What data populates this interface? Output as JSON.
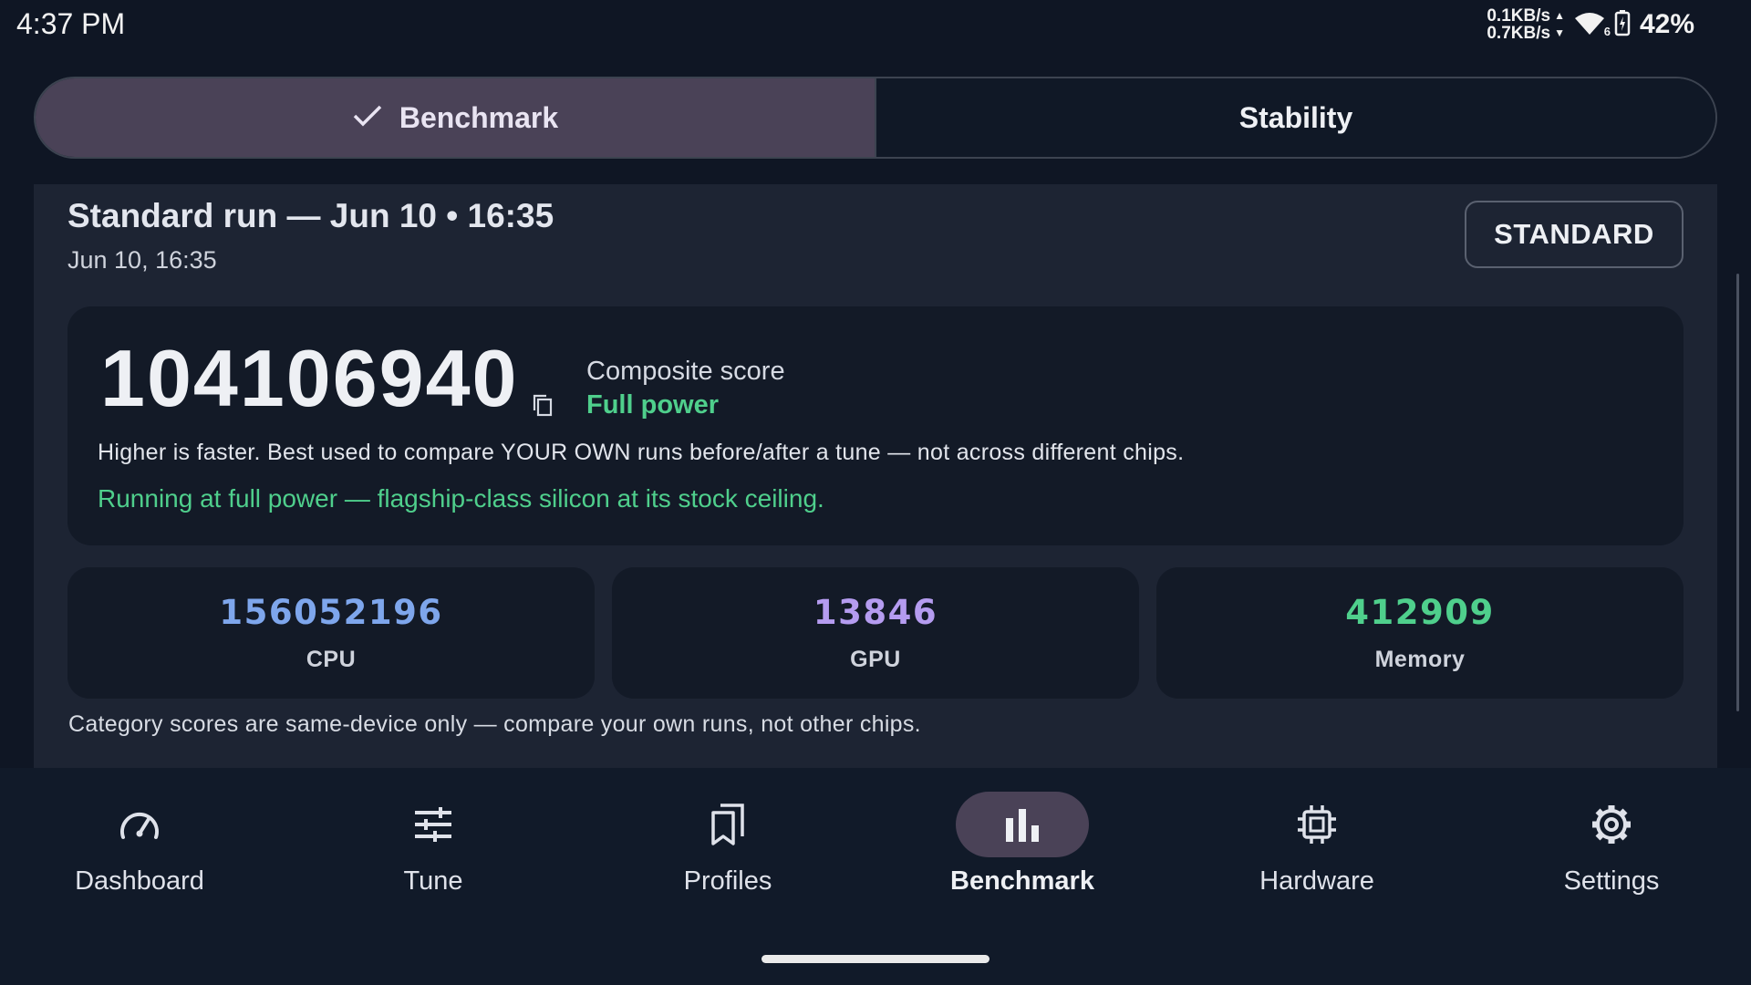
{
  "status_bar": {
    "time": "4:37 PM",
    "net_up": "0.1KB/s",
    "net_down": "0.7KB/s",
    "wifi_badge": "6",
    "battery": "42%"
  },
  "tabs": [
    {
      "label": "Benchmark",
      "selected": true
    },
    {
      "label": "Stability",
      "selected": false
    }
  ],
  "run": {
    "title": "Standard run — Jun 10 • 16:35",
    "subtitle": "Jun 10, 16:35",
    "mode_button": "STANDARD"
  },
  "score": {
    "composite_value": "104106940",
    "composite_label": "Composite score",
    "power_label": "Full power",
    "note": "Higher is faster. Best used to compare YOUR OWN runs before/after a tune — not across different chips.",
    "power_note": "Running at full power — flagship-class silicon at its stock ceiling."
  },
  "categories": [
    {
      "value": "156052196",
      "label": "CPU",
      "color": "#7ea6ec"
    },
    {
      "value": "13846",
      "label": "GPU",
      "color": "#b59cf0"
    },
    {
      "value": "412909",
      "label": "Memory",
      "color": "#4fcf8c"
    }
  ],
  "category_note": "Category scores are same-device only — compare your own runs, not other chips.",
  "colors": {
    "accent_green": "#4fcf8c",
    "active_tab": "#4a4257",
    "background": "#0f1624"
  },
  "nav": [
    {
      "label": "Dashboard",
      "icon": "speedometer-icon",
      "active": false
    },
    {
      "label": "Tune",
      "icon": "sliders-icon",
      "active": false
    },
    {
      "label": "Profiles",
      "icon": "bookmarks-icon",
      "active": false
    },
    {
      "label": "Benchmark",
      "icon": "bar-chart-icon",
      "active": true
    },
    {
      "label": "Hardware",
      "icon": "chip-icon",
      "active": false
    },
    {
      "label": "Settings",
      "icon": "gear-icon",
      "active": false
    }
  ]
}
